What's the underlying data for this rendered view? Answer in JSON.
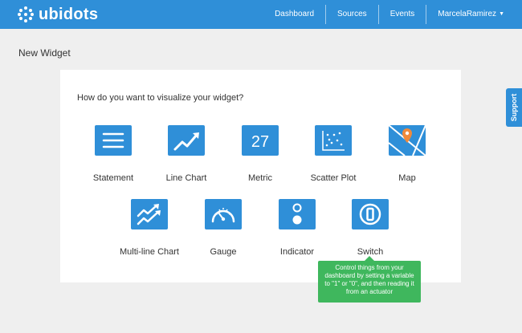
{
  "brand": {
    "name": "ubidots",
    "logo_icon": "dot-grid-logo-icon"
  },
  "nav": {
    "dashboard": "Dashboard",
    "sources": "Sources",
    "events": "Events",
    "user": "MarcelaRamirez",
    "user_caret_icon": "caret-down-icon"
  },
  "page": {
    "title": "New Widget"
  },
  "panel": {
    "question": "How do you want to visualize your widget?",
    "widgets": [
      {
        "label": "Statement",
        "icon": "statement-icon"
      },
      {
        "label": "Line Chart",
        "icon": "line-chart-icon"
      },
      {
        "label": "Metric",
        "icon": "metric-icon",
        "icon_text": "27"
      },
      {
        "label": "Scatter Plot",
        "icon": "scatter-plot-icon"
      },
      {
        "label": "Map",
        "icon": "map-icon"
      },
      {
        "label": "Multi-line Chart",
        "icon": "multi-line-chart-icon"
      },
      {
        "label": "Gauge",
        "icon": "gauge-icon"
      },
      {
        "label": "Indicator",
        "icon": "indicator-icon"
      },
      {
        "label": "Switch",
        "icon": "switch-icon"
      }
    ]
  },
  "tooltip": {
    "text": "Control things from your dashboard by setting a variable to \"1\" or \"0\", and then reading it from an actuator"
  },
  "support": {
    "label": "Support"
  },
  "colors": {
    "primary": "#2f8fd8",
    "tooltip": "#3fb75d",
    "background": "#efefef",
    "hover": "#c8c8c8"
  }
}
